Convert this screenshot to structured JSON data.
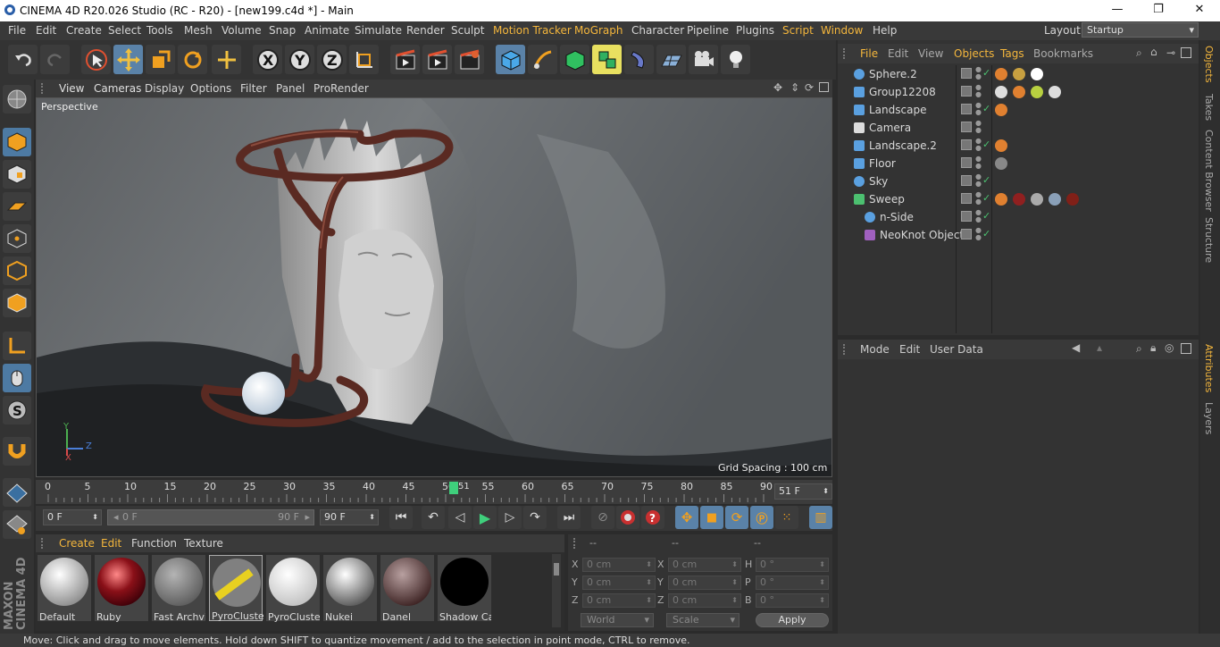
{
  "window": {
    "title": "CINEMA 4D R20.026 Studio (RC - R20) - [new199.c4d *] - Main",
    "minimize": "—",
    "restore": "❐",
    "close": "✕"
  },
  "menu": [
    {
      "label": "File",
      "hl": false
    },
    {
      "label": "Edit",
      "hl": false
    },
    {
      "label": "Create",
      "hl": false
    },
    {
      "label": "Select",
      "hl": false
    },
    {
      "label": "Tools",
      "hl": false
    },
    {
      "label": "Mesh",
      "hl": false
    },
    {
      "label": "Volume",
      "hl": false
    },
    {
      "label": "Snap",
      "hl": false
    },
    {
      "label": "Animate",
      "hl": false
    },
    {
      "label": "Simulate",
      "hl": false
    },
    {
      "label": "Render",
      "hl": false
    },
    {
      "label": "Sculpt",
      "hl": false
    },
    {
      "label": "Motion Tracker",
      "hl": true
    },
    {
      "label": "MoGraph",
      "hl": true
    },
    {
      "label": "Character",
      "hl": false
    },
    {
      "label": "Pipeline",
      "hl": false
    },
    {
      "label": "Plugins",
      "hl": false
    },
    {
      "label": "Script",
      "hl": true
    },
    {
      "label": "Window",
      "hl": true
    },
    {
      "label": "Help",
      "hl": false
    }
  ],
  "layout": {
    "label": "Layout:",
    "value": "Startup"
  },
  "viewport": {
    "menu": [
      "View",
      "Cameras",
      "Display",
      "Options",
      "Filter",
      "Panel",
      "ProRender"
    ],
    "camera_label": "Perspective",
    "grid_spacing": "Grid Spacing : 100 cm",
    "axis": {
      "y": "Y",
      "z": "Z",
      "x": "X"
    }
  },
  "timeline": {
    "ticks": [
      "0",
      "5",
      "10",
      "15",
      "20",
      "25",
      "30",
      "35",
      "40",
      "45",
      "50",
      "55",
      "60",
      "65",
      "70",
      "75",
      "80",
      "85",
      "90"
    ],
    "current_frame": "51",
    "frame_field": "51 F"
  },
  "transport": {
    "start_field": "0 F",
    "range_start": "0 F",
    "range_end": "90 F",
    "end_field": "90 F"
  },
  "materials": {
    "menu": [
      "Create",
      "Edit",
      "Function",
      "Texture"
    ],
    "items": [
      {
        "name": "Default"
      },
      {
        "name": "Ruby"
      },
      {
        "name": "Fast Archvi"
      },
      {
        "name": "PyroCluster"
      },
      {
        "name": "PyroCluster"
      },
      {
        "name": "Nukei"
      },
      {
        "name": "Danel"
      },
      {
        "name": "Shadow Ca"
      }
    ]
  },
  "coordinates": {
    "header": [
      "--",
      "--",
      "--"
    ],
    "rows": [
      {
        "a": "X",
        "av": "0 cm",
        "b": "X",
        "bv": "0 cm",
        "c": "H",
        "cv": "0 °"
      },
      {
        "a": "Y",
        "av": "0 cm",
        "b": "Y",
        "bv": "0 cm",
        "c": "P",
        "cv": "0 °"
      },
      {
        "a": "Z",
        "av": "0 cm",
        "b": "Z",
        "bv": "0 cm",
        "c": "B",
        "cv": "0 °"
      }
    ],
    "world": "World",
    "scale": "Scale",
    "apply": "Apply"
  },
  "objects": {
    "menu": [
      "File",
      "Edit",
      "View",
      "Objects",
      "Tags",
      "Bookmarks"
    ],
    "items": [
      {
        "name": "Sphere.2",
        "icon": "sphere-icon",
        "indent": 0
      },
      {
        "name": "Group12208",
        "icon": "null-icon",
        "indent": 0
      },
      {
        "name": "Landscape",
        "icon": "landscape-icon",
        "indent": 0
      },
      {
        "name": "Camera",
        "icon": "camera-icon",
        "indent": 0
      },
      {
        "name": "Landscape.2",
        "icon": "landscape-icon",
        "indent": 0
      },
      {
        "name": "Floor",
        "icon": "floor-icon",
        "indent": 0
      },
      {
        "name": "Sky",
        "icon": "sky-icon",
        "indent": 0
      },
      {
        "name": "Sweep",
        "icon": "sweep-icon",
        "indent": 0
      },
      {
        "name": "n-Side",
        "icon": "nside-icon",
        "indent": 1
      },
      {
        "name": "NeoKnot Object",
        "icon": "knot-icon",
        "indent": 1
      }
    ]
  },
  "attributes": {
    "menu": [
      "Mode",
      "Edit",
      "User Data"
    ]
  },
  "dock_tabs": [
    "Objects",
    "Takes",
    "Content Browser",
    "Structure",
    "Attributes",
    "Layers"
  ],
  "status": "Move: Click and drag to move elements. Hold down SHIFT to quantize movement / add to the selection in point mode, CTRL to remove.",
  "brand": "MAXON CINEMA 4D"
}
